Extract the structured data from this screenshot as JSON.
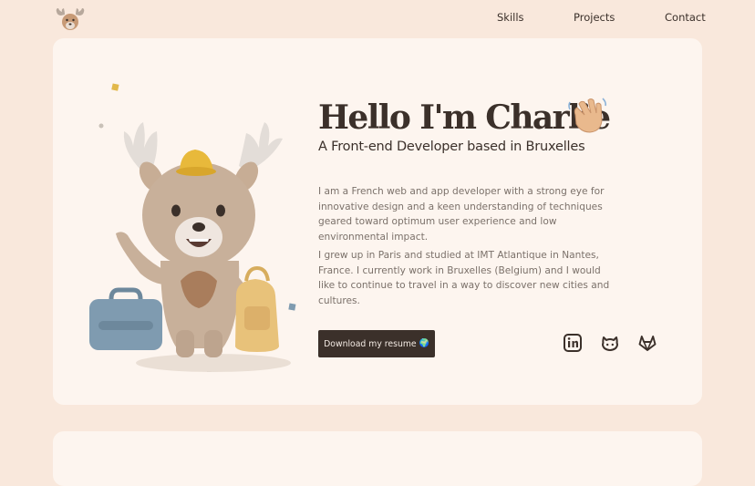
{
  "nav": {
    "logo_name": "moose-logo",
    "links": [
      "Skills",
      "Projects",
      "Contact"
    ]
  },
  "hero": {
    "title": "Hello I'm Charlie",
    "title_emoji": "waving-hand",
    "subtitle": "A Front-end Developer based in Bruxelles",
    "paragraphs": [
      "I am a French web and app developer with a strong eye for innovative design and a keen understanding of techniques geared toward optimum user experience and low environmental impact.",
      "I grew up in Paris and studied at IMT Atlantique in Nantes, France. I currently work in Bruxelles (Belgium) and I would like to continue to travel in a way to discover new cities and cultures."
    ],
    "resume_button": "Download my resume",
    "resume_icon": "globe-icon",
    "social": [
      "linkedin-icon",
      "github-icon",
      "gitlab-icon"
    ]
  },
  "colors": {
    "page_bg": "#f9e8dc",
    "card_bg": "#fdf5ef",
    "text_dark": "#3b302a",
    "text_muted": "#7b716a"
  }
}
